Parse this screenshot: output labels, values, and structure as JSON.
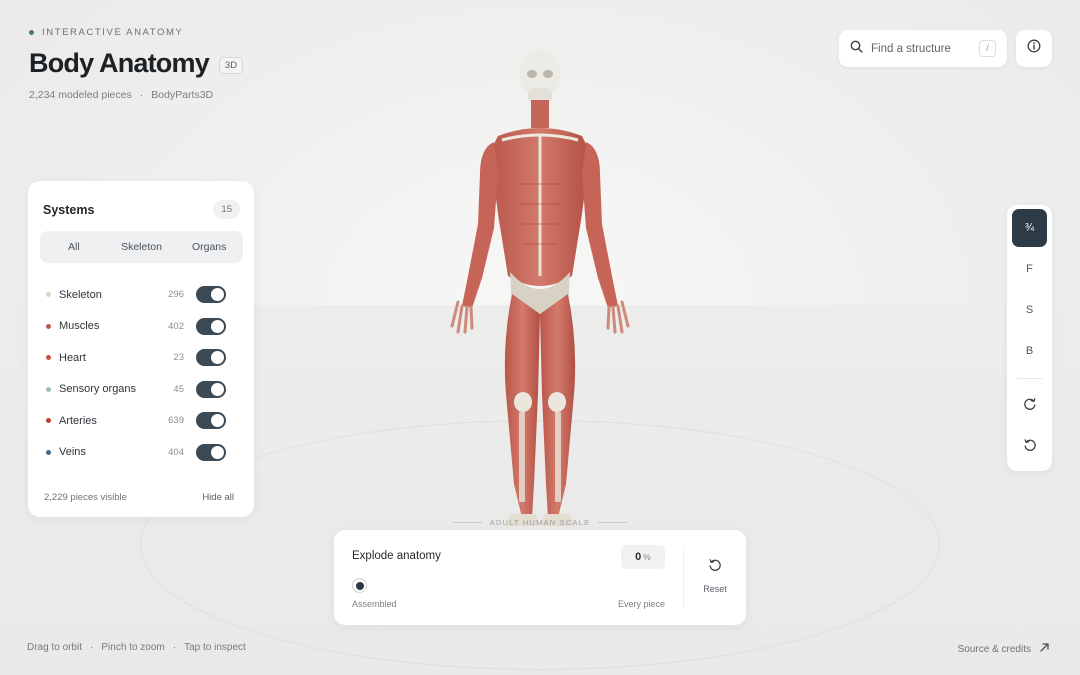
{
  "header": {
    "eyebrow": "INTERACTIVE ANATOMY",
    "title": "Body Anatomy",
    "badge": "3D",
    "pieces": "2,234 modeled pieces",
    "separator": "·",
    "source": "BodyParts3D"
  },
  "search": {
    "placeholder": "Find a structure",
    "shortcut": "/",
    "icon": "search-icon"
  },
  "info": {
    "icon": "info-icon"
  },
  "systems": {
    "title": "Systems",
    "count": "15",
    "filters": [
      "All",
      "Skeleton",
      "Organs"
    ],
    "items": [
      {
        "name": "Skeleton",
        "count": "296",
        "color": "#d9d3c6",
        "on": true
      },
      {
        "name": "Muscles",
        "count": "402",
        "color": "#b55a4c",
        "on": true
      },
      {
        "name": "Heart",
        "count": "23",
        "color": "#c4523d",
        "on": true
      },
      {
        "name": "Sensory organs",
        "count": "45",
        "color": "#9cbdb8",
        "on": true
      },
      {
        "name": "Arteries",
        "count": "639",
        "color": "#b8432e",
        "on": true
      },
      {
        "name": "Veins",
        "count": "404",
        "color": "#3f6a8c",
        "on": true
      }
    ],
    "visible": "2,229 pieces visible",
    "hide_all": "Hide all"
  },
  "scale_label": "ADULT HUMAN SCALE",
  "explode": {
    "title": "Explode anatomy",
    "value": "0",
    "unit": "%",
    "min_label": "Assembled",
    "max_label": "Every piece",
    "reset": "Reset",
    "level": 0
  },
  "views": {
    "items": [
      "¾",
      "F",
      "S",
      "B"
    ],
    "active": "¾",
    "rotate_cw_icon": "rotate-cw-icon",
    "rotate_ccw_icon": "rotate-ccw-icon"
  },
  "footer": {
    "hints": [
      "Drag to orbit",
      "Pinch to zoom",
      "Tap to inspect"
    ],
    "hint_sep": "·",
    "credits": "Source & credits"
  },
  "colors": {
    "accent": "#2c3b45",
    "live_dot": "#3f7d68"
  }
}
